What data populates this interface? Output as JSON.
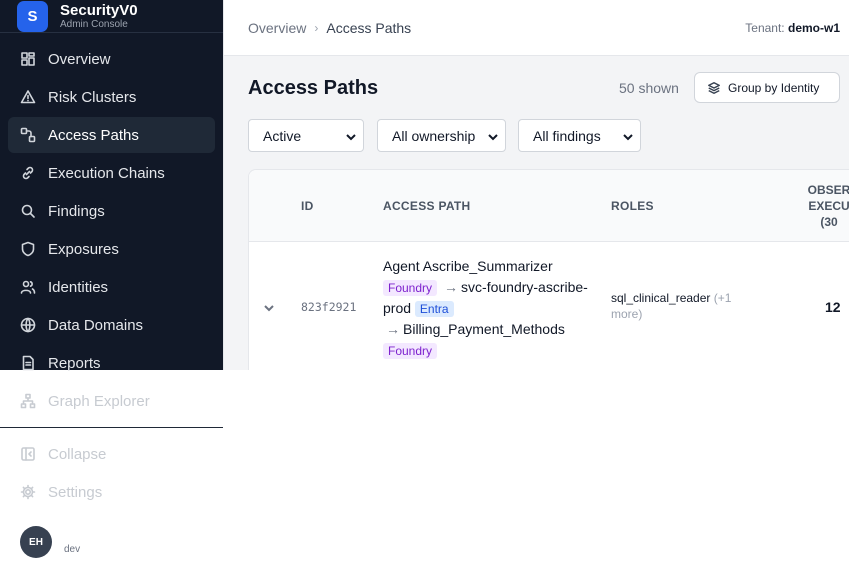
{
  "app": {
    "logo_letter": "S",
    "name": "SecurityV0",
    "subtitle": "Admin Console"
  },
  "nav": [
    {
      "label": "Overview",
      "icon": "grid-icon",
      "active": false
    },
    {
      "label": "Risk Clusters",
      "icon": "warning-triangle-icon",
      "active": false
    },
    {
      "label": "Access Paths",
      "icon": "path-icon",
      "active": true
    },
    {
      "label": "Execution Chains",
      "icon": "link-icon",
      "active": false
    },
    {
      "label": "Findings",
      "icon": "search-icon",
      "active": false
    },
    {
      "label": "Exposures",
      "icon": "shield-icon",
      "active": false
    },
    {
      "label": "Identities",
      "icon": "users-icon",
      "active": false
    },
    {
      "label": "Data Domains",
      "icon": "globe-icon",
      "active": false
    },
    {
      "label": "Reports",
      "icon": "document-icon",
      "active": false
    }
  ],
  "lower_nav": {
    "graph": "Graph Explorer",
    "collapse": "Collapse",
    "settings": "Settings"
  },
  "user": {
    "initials": "EH",
    "name": "dev"
  },
  "breadcrumb": {
    "root": "Overview",
    "current": "Access Paths"
  },
  "tenant": {
    "label": "Tenant:",
    "value": "demo-w1"
  },
  "page": {
    "title": "Access Paths",
    "shown": "50 shown",
    "group_button": "Group by Identity"
  },
  "filters": {
    "status": "Active",
    "ownership": "All ownership",
    "findings": "All findings"
  },
  "table": {
    "headers": {
      "id": "ID",
      "path": "ACCESS PATH",
      "roles": "ROLES",
      "observed_1": "OBSER",
      "observed_2": "EXECU",
      "observed_3": "(30"
    },
    "rows": [
      {
        "id": "823f2921",
        "source": "Agent Ascribe_Summarizer",
        "source_tag": "Foundry",
        "mid": "svc-foundry-ascribe-prod",
        "mid_tag": "Entra",
        "target": "Billing_Payment_Methods",
        "target_tag": "Foundry",
        "role": "sql_clinical_reader",
        "role_more": "(+1 more)",
        "observed": "12"
      }
    ]
  },
  "colors": {
    "sidebar": "#111827",
    "accent": "#2563eb",
    "foundry_tag": "#7e22ce",
    "entra_tag": "#1d4ed8"
  }
}
